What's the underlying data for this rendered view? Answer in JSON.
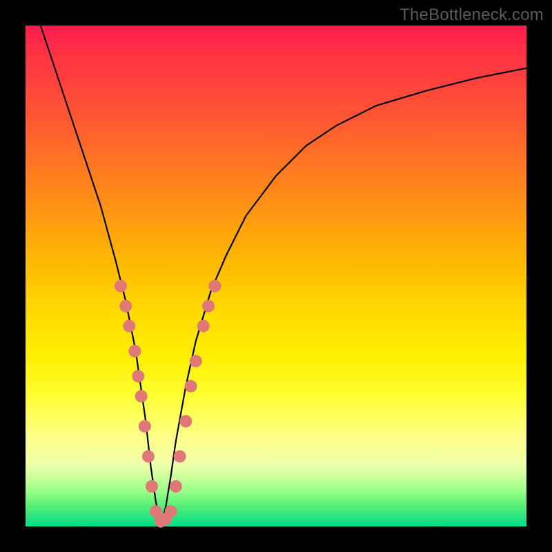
{
  "watermark": "TheBottleneck.com",
  "chart_data": {
    "type": "line",
    "title": "",
    "xlabel": "",
    "ylabel": "",
    "xlim": [
      0,
      100
    ],
    "ylim": [
      0,
      100
    ],
    "background_gradient": {
      "top": "#ff1a4d",
      "mid": "#ffee00",
      "bottom": "#00dd88",
      "meaning": "heat scale red (bad) to green (good)"
    },
    "curve": {
      "description": "V-shaped bottleneck curve; minimum near x≈27, rising steeply on both sides",
      "x": [
        3,
        6,
        9,
        12,
        15,
        18,
        20,
        22,
        24,
        25,
        26,
        27,
        28,
        29,
        30,
        32,
        34,
        37,
        40,
        44,
        50,
        56,
        62,
        70,
        80,
        90,
        100
      ],
      "y": [
        100,
        91,
        82,
        73,
        64,
        53,
        45,
        35,
        21,
        12,
        5,
        0,
        4,
        10,
        17,
        28,
        37,
        47,
        54,
        62,
        70,
        76,
        80,
        84,
        87,
        89.5,
        91.5
      ]
    },
    "markers": {
      "description": "salmon circular markers on lower portion of V curve",
      "color": "#e07878",
      "radius_px": 9,
      "points": [
        {
          "x": 19,
          "y": 48
        },
        {
          "x": 20,
          "y": 44
        },
        {
          "x": 20.7,
          "y": 40
        },
        {
          "x": 21.8,
          "y": 35
        },
        {
          "x": 22.5,
          "y": 30
        },
        {
          "x": 23.1,
          "y": 26
        },
        {
          "x": 23.8,
          "y": 20
        },
        {
          "x": 24.5,
          "y": 14
        },
        {
          "x": 25.2,
          "y": 8
        },
        {
          "x": 26,
          "y": 3
        },
        {
          "x": 27,
          "y": 1
        },
        {
          "x": 28,
          "y": 1.5
        },
        {
          "x": 29,
          "y": 3
        },
        {
          "x": 30,
          "y": 8
        },
        {
          "x": 30.8,
          "y": 14
        },
        {
          "x": 32,
          "y": 21
        },
        {
          "x": 33,
          "y": 28
        },
        {
          "x": 34,
          "y": 33
        },
        {
          "x": 35.5,
          "y": 40
        },
        {
          "x": 36.5,
          "y": 44
        },
        {
          "x": 37.8,
          "y": 48
        }
      ]
    }
  }
}
